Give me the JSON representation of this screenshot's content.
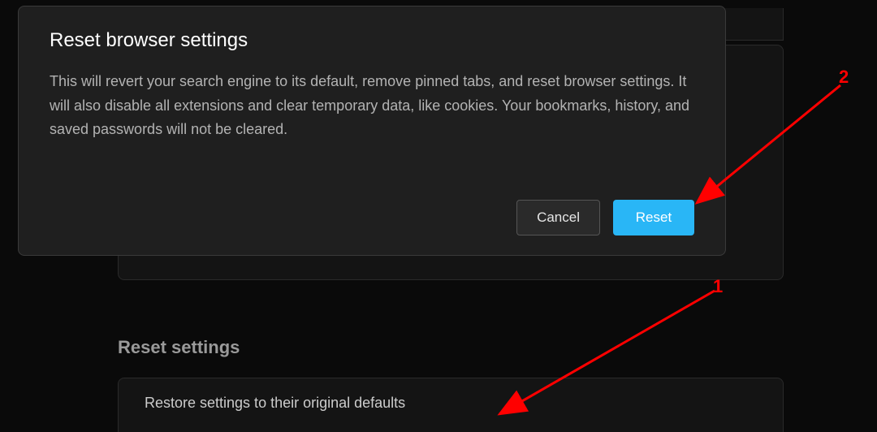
{
  "dialog": {
    "title": "Reset browser settings",
    "body": "This will revert your search engine to its default, remove pinned tabs, and reset browser settings. It will also disable all extensions and clear temporary data, like cookies. Your bookmarks, history, and saved passwords will not be cleared.",
    "cancel_label": "Cancel",
    "reset_label": "Reset"
  },
  "page": {
    "section_header": "Reset settings",
    "row_label": "Restore settings to their original defaults"
  },
  "annotations": {
    "label1": "1",
    "label2": "2"
  },
  "colors": {
    "accent": "#29b6f6",
    "annotation": "#ff0000"
  }
}
